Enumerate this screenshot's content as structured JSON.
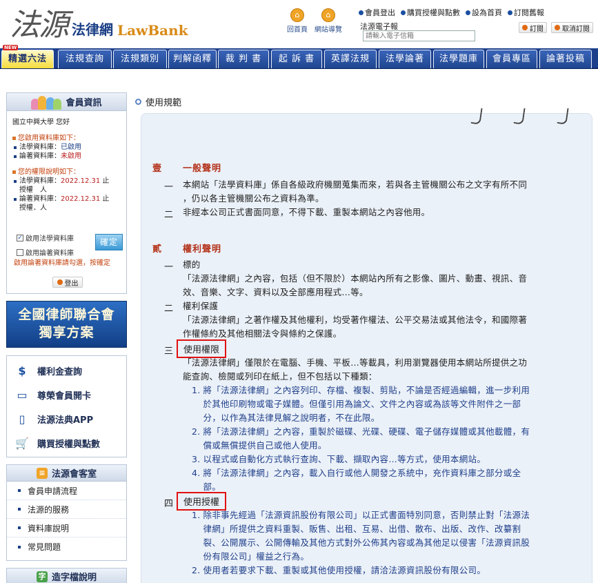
{
  "header": {
    "logo_calligraphy": "法源",
    "logo_cname": "法律網",
    "logo_ename": "LawBank",
    "home_label": "回首頁",
    "sitemap_label": "網站導覽",
    "top_links": [
      "會員登出",
      "購買授權與點數",
      "設為首頁",
      "訂閱舊報"
    ],
    "newsletter_label": "法源電子報",
    "newsletter_placeholder": "請輸入電子信箱",
    "subscribe_label": "訂閱",
    "unsubscribe_label": "取消訂閱"
  },
  "nav": {
    "new_badge": "NEW",
    "tabs": [
      "精選六法",
      "法規查詢",
      "法規類別",
      "判解函釋",
      "裁 判 書",
      "起 訴 書",
      "英譯法規",
      "法學論著",
      "法學題庫",
      "會員專區",
      "論著投稿"
    ]
  },
  "member": {
    "title": "會員資訊",
    "welcome": "國立中興大學 您好",
    "enabled_heading": "您啟用資料庫如下：",
    "enabled_items": [
      {
        "name": "法學資料庫：",
        "status": "已啟用"
      },
      {
        "name": "論著資料庫：",
        "status": "未啟用"
      }
    ],
    "rights_heading": "您的權限說明如下：",
    "rights_items": [
      {
        "name": "法學資料庫：",
        "date": "2022.12.31",
        "suffix": "止",
        "line2": "授權　人"
      },
      {
        "name": "論著資料庫：",
        "date": "2022.12.31",
        "suffix": "止",
        "line2": "授權．人"
      }
    ],
    "check_law": "啟用法學資料庫",
    "check_paper": "啟用論著資料庫",
    "confirm_label": "確定",
    "enable_note": "啟用論著資料庫請勾選，按確定",
    "logout_label": "登出"
  },
  "banner": {
    "line1": "全國律師聯合會",
    "line2": "獨享方案"
  },
  "services": [
    {
      "label": "權利金查詢",
      "icon": "money-bag-icon"
    },
    {
      "label": "尊榮會員開卡",
      "icon": "card-icon"
    },
    {
      "label": "法源法典APP",
      "icon": "phone-icon"
    },
    {
      "label": "購買授權與點數",
      "icon": "cart-icon"
    }
  ],
  "guest": {
    "title": "法源會客室",
    "items": [
      "會員申請流程",
      "法源的服務",
      "資料庫說明",
      "常見問題"
    ]
  },
  "font_box": {
    "title": "造字檔說明"
  },
  "main": {
    "page_title": "使用規範",
    "sec1": {
      "num": "壹",
      "title": "一般聲明",
      "items": [
        {
          "num": "一",
          "lines": [
            "本網站「法學資料庫」係自各級政府機關蒐集而來，若與各主管機關公布之文字有所不同",
            "，仍以各主管機關公布之資料為準。"
          ]
        },
        {
          "num": "二",
          "lines": [
            "非經本公司正式書面同意，不得下載、重製本網站之內容他用。"
          ]
        }
      ]
    },
    "sec2": {
      "num": "貳",
      "title": "權利聲明",
      "item1": {
        "num": "一",
        "title": "標的",
        "lines": [
          "「法源法律網」之內容，包括（但不限於）本網站內所有之影像、圖片、動畫、視訊、音",
          "效、音樂、文字、資料以及全部應用程式…等。"
        ]
      },
      "item2": {
        "num": "二",
        "title": "權利保護",
        "lines": [
          "「法源法律網」之著作權及其他權利，均受著作權法、公平交易法或其他法令，和國際著",
          "作權條約及其他相關法令與條約之保護。"
        ]
      },
      "item3": {
        "num": "三",
        "title": "使用權限",
        "lines": [
          "「法源法律網」僅限於在電腦、手機、平板…等載具，利用瀏覽器使用本網站所提供之功",
          "能查詢、檢閱或列印在紙上，但不包括以下種類："
        ],
        "sub": [
          {
            "num": "1.",
            "lines": [
              "將「法源法律網」之內容列印、存檔、複製、剪貼，不論是否經過編輯，進一步利用",
              "於其他印刷物或電子媒體。但僅引用為論文、文件之內容或為該等文件附件之一部",
              "分，以作為其法律見解之說明者，不在此限。"
            ]
          },
          {
            "num": "2.",
            "lines": [
              "將「法源法律網」之內容，重製於磁碟、光碟、硬碟、電子儲存媒體或其他載體，有",
              "償或無償提供自己或他人使用。"
            ]
          },
          {
            "num": "3.",
            "lines": [
              "以程式或自動化方式執行查詢、下載、擷取內容…等方式，使用本網站。"
            ]
          },
          {
            "num": "4.",
            "lines": [
              "將「法源法律網」之內容，載入自行或他人開發之系統中，充作資料庫之部分或全",
              "部。"
            ]
          }
        ]
      },
      "item4": {
        "num": "四",
        "title": "使用授權",
        "sub": [
          {
            "num": "1.",
            "lines": [
              "除非事先經過「法源資訊股份有限公司」以正式書面特別同意，否則禁止對「法源法",
              "律網」所提供之資料重製、販售、出租、互易、出借、散布、出版、改作、改纂割",
              "裂、公開展示、公開傳輸及其他方式對外公佈其內容或為其他足以侵害「法源資訊股",
              "份有限公司」權益之行為。"
            ]
          },
          {
            "num": "2.",
            "lines": [
              "使用者若要求下載、重製或其他使用授權，請洽法源資訊股份有限公司。"
            ]
          }
        ]
      }
    }
  },
  "colors": {
    "nav_blue": "#1c3f8c",
    "active_tab": "#f5dc3c",
    "section_red": "#b4331c",
    "highlight_box": "#e01010",
    "sublist_blue": "#1f3f8a"
  }
}
